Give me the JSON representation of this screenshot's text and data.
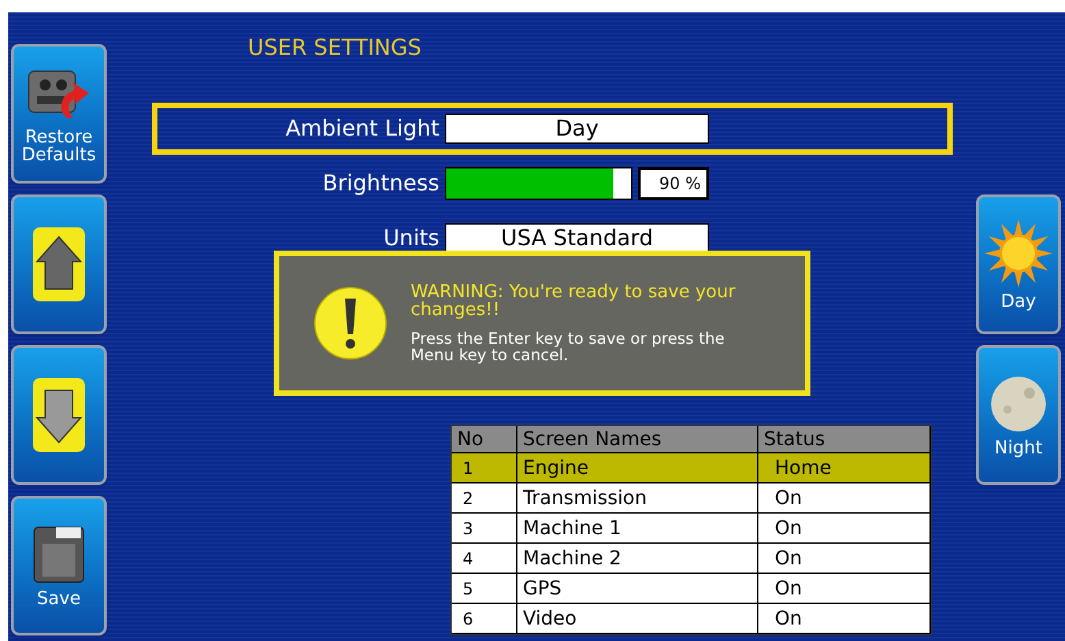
{
  "title": "USER SETTINGS",
  "left_buttons": [
    {
      "kind": "restore",
      "label": "Restore Defaults"
    },
    {
      "kind": "up"
    },
    {
      "kind": "down"
    },
    {
      "kind": "save",
      "label": "Save"
    }
  ],
  "settings": [
    {
      "kind": "select",
      "label": "Ambient Light",
      "value": "Day",
      "selected": true
    },
    {
      "kind": "slider",
      "label": "Brightness",
      "level": 0.9,
      "reading": "90 %",
      "selected": false
    },
    {
      "kind": "select",
      "label": "Units",
      "value": "USA Standard",
      "selected": false
    }
  ],
  "dialog": {
    "heading": "WARNING: You're ready to save your changes!!",
    "message": "Press the Enter key to save or press the Menu key to cancel."
  },
  "table": {
    "columns": [
      "No",
      "Screen Names",
      "Status"
    ],
    "rows": [
      {
        "cells": [
          "1",
          "Engine",
          "Home"
        ],
        "selected": true
      },
      {
        "cells": [
          "2",
          "Transmission",
          "On"
        ],
        "selected": false
      },
      {
        "cells": [
          "3",
          "Machine 1",
          "On"
        ],
        "selected": false
      },
      {
        "cells": [
          "4",
          "Machine 2",
          "On"
        ],
        "selected": false
      },
      {
        "cells": [
          "5",
          "GPS",
          "On"
        ],
        "selected": false
      },
      {
        "cells": [
          "6",
          "Video",
          "On"
        ],
        "selected": false
      }
    ]
  },
  "right_buttons": [
    {
      "kind": "sun",
      "label": "Day"
    },
    {
      "kind": "moon",
      "label": "Night"
    }
  ]
}
